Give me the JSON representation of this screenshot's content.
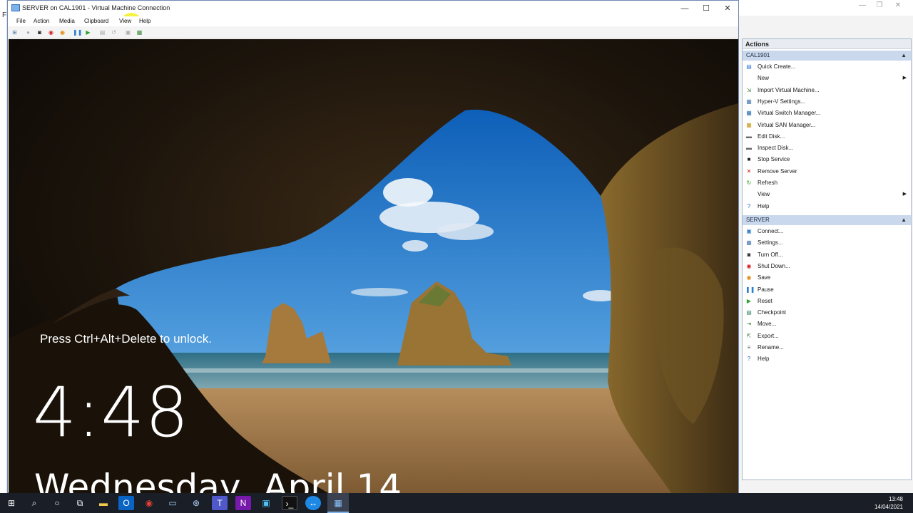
{
  "vm_window": {
    "title": "SERVER on CAL1901 - Virtual Machine Connection",
    "minimize": "—",
    "maximize": "☐",
    "close": "✕",
    "menu": [
      "File",
      "Action",
      "Media",
      "Clipboard",
      "View",
      "Help"
    ],
    "highlight_color": "#f5f01e"
  },
  "lock_screen": {
    "unlock_prompt": "Press Ctrl+Alt+Delete to unlock.",
    "time": "4:48",
    "date": "Wednesday, April 14"
  },
  "hyperv_manager": {
    "left_strip_letter": "F",
    "actions_title": "Actions",
    "host_section": {
      "name": "CAL1901",
      "items": [
        {
          "label": "Quick Create...",
          "icon": "quick-create-icon"
        },
        {
          "label": "New",
          "icon": "none",
          "submenu": true
        },
        {
          "label": "Import Virtual Machine...",
          "icon": "import-icon"
        },
        {
          "label": "Hyper-V Settings...",
          "icon": "settings-icon"
        },
        {
          "label": "Virtual Switch Manager...",
          "icon": "switch-icon"
        },
        {
          "label": "Virtual SAN Manager...",
          "icon": "san-icon"
        },
        {
          "label": "Edit Disk...",
          "icon": "edit-disk-icon"
        },
        {
          "label": "Inspect Disk...",
          "icon": "inspect-disk-icon"
        },
        {
          "label": "Stop Service",
          "icon": "stop-icon"
        },
        {
          "label": "Remove Server",
          "icon": "remove-icon"
        },
        {
          "label": "Refresh",
          "icon": "refresh-icon"
        },
        {
          "label": "View",
          "icon": "none",
          "submenu": true
        },
        {
          "label": "Help",
          "icon": "help-icon"
        }
      ]
    },
    "vm_section": {
      "name": "SERVER",
      "items": [
        {
          "label": "Connect...",
          "icon": "connect-icon"
        },
        {
          "label": "Settings...",
          "icon": "settings-icon"
        },
        {
          "label": "Turn Off...",
          "icon": "turn-off-icon"
        },
        {
          "label": "Shut Down...",
          "icon": "shut-down-icon"
        },
        {
          "label": "Save",
          "icon": "save-icon"
        },
        {
          "label": "Pause",
          "icon": "pause-icon"
        },
        {
          "label": "Reset",
          "icon": "reset-icon"
        },
        {
          "label": "Checkpoint",
          "icon": "checkpoint-icon"
        },
        {
          "label": "Move...",
          "icon": "move-icon"
        },
        {
          "label": "Export...",
          "icon": "export-icon"
        },
        {
          "label": "Rename...",
          "icon": "rename-icon"
        },
        {
          "label": "Help",
          "icon": "help-icon"
        }
      ]
    }
  },
  "taskbar": {
    "clock_time": "13:48",
    "clock_date": "14/04/2021"
  }
}
